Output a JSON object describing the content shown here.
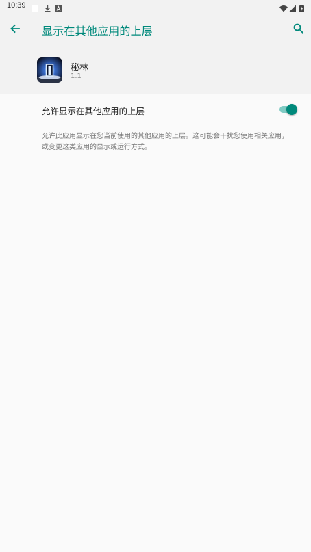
{
  "status_bar": {
    "time": "10:39",
    "notification_icons": [
      "blank-notification-icon",
      "download-icon",
      "a-letter-icon"
    ],
    "system_icons": [
      "wifi-icon",
      "cellular-signal-icon",
      "battery-icon"
    ]
  },
  "app_bar": {
    "back_icon": "arrow-back-icon",
    "title": "显示在其他应用的上层",
    "search_icon": "search-icon"
  },
  "app_info": {
    "name": "秘林",
    "version": "1.1"
  },
  "setting": {
    "label": "允许显示在其他应用的上层",
    "enabled": true
  },
  "description": "允许此应用显示在您当前使用的其他应用的上层。这可能会干扰您使用相关应用，或变更这类应用的显示或运行方式。",
  "colors": {
    "accent": "#00897b",
    "accent_light": "#80cbc4",
    "background": "#fafafa",
    "header_background": "#f2f2f2"
  }
}
